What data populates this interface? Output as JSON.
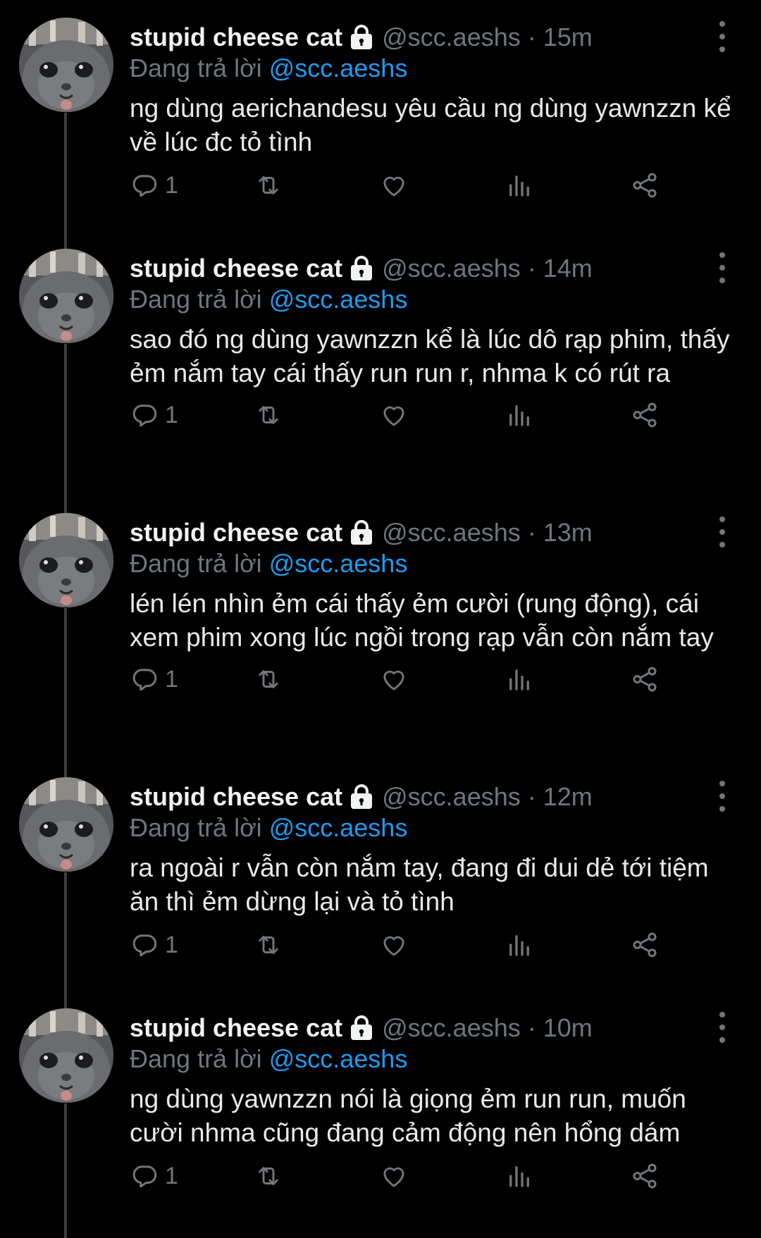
{
  "tweets": [
    {
      "name": "stupid cheese cat",
      "handle": "@scc.aeshs",
      "time": "15m",
      "replying_prefix": "Đang trả lời",
      "replying_to": "@scc.aeshs",
      "text": "ng dùng aerichandesu yêu cầu ng dùng yawnzzn kể về lúc đc tỏ tình",
      "reply_count": "1"
    },
    {
      "name": "stupid cheese cat",
      "handle": "@scc.aeshs",
      "time": "14m",
      "replying_prefix": "Đang trả lời",
      "replying_to": "@scc.aeshs",
      "text": "sao đó ng dùng yawnzzn kể là lúc dô rạp phim, thấy ẻm nắm tay cái thấy run run r, nhma k có rút ra",
      "reply_count": "1"
    },
    {
      "name": "stupid cheese cat",
      "handle": "@scc.aeshs",
      "time": "13m",
      "replying_prefix": "Đang trả lời",
      "replying_to": "@scc.aeshs",
      "text": "lén lén nhìn ẻm cái thấy ẻm cười (rung động), cái xem phim xong lúc ngồi trong rạp vẫn còn nắm tay",
      "reply_count": "1"
    },
    {
      "name": "stupid cheese cat",
      "handle": "@scc.aeshs",
      "time": "12m",
      "replying_prefix": "Đang trả lời",
      "replying_to": "@scc.aeshs",
      "text": "ra ngoài r vẫn còn nắm tay, đang đi dui dẻ tới tiệm ăn thì ẻm dừng lại và tỏ tình",
      "reply_count": "1"
    },
    {
      "name": "stupid cheese cat",
      "handle": "@scc.aeshs",
      "time": "10m",
      "replying_prefix": "Đang trả lời",
      "replying_to": "@scc.aeshs",
      "text": "ng dùng yawnzzn nói là giọng ẻm run run, muốn cười nhma cũng đang cảm động nên hổng dám",
      "reply_count": "1"
    }
  ],
  "separator": "·",
  "icons": {
    "lock": "lock-icon",
    "more": "more-vertical-icon",
    "reply": "reply-icon",
    "retweet": "retweet-icon",
    "like": "heart-icon",
    "views": "views-icon",
    "share": "share-icon"
  },
  "colors": {
    "background": "#000000",
    "text": "#e7e9ea",
    "muted": "#71767b",
    "link": "#1d9bf0"
  }
}
